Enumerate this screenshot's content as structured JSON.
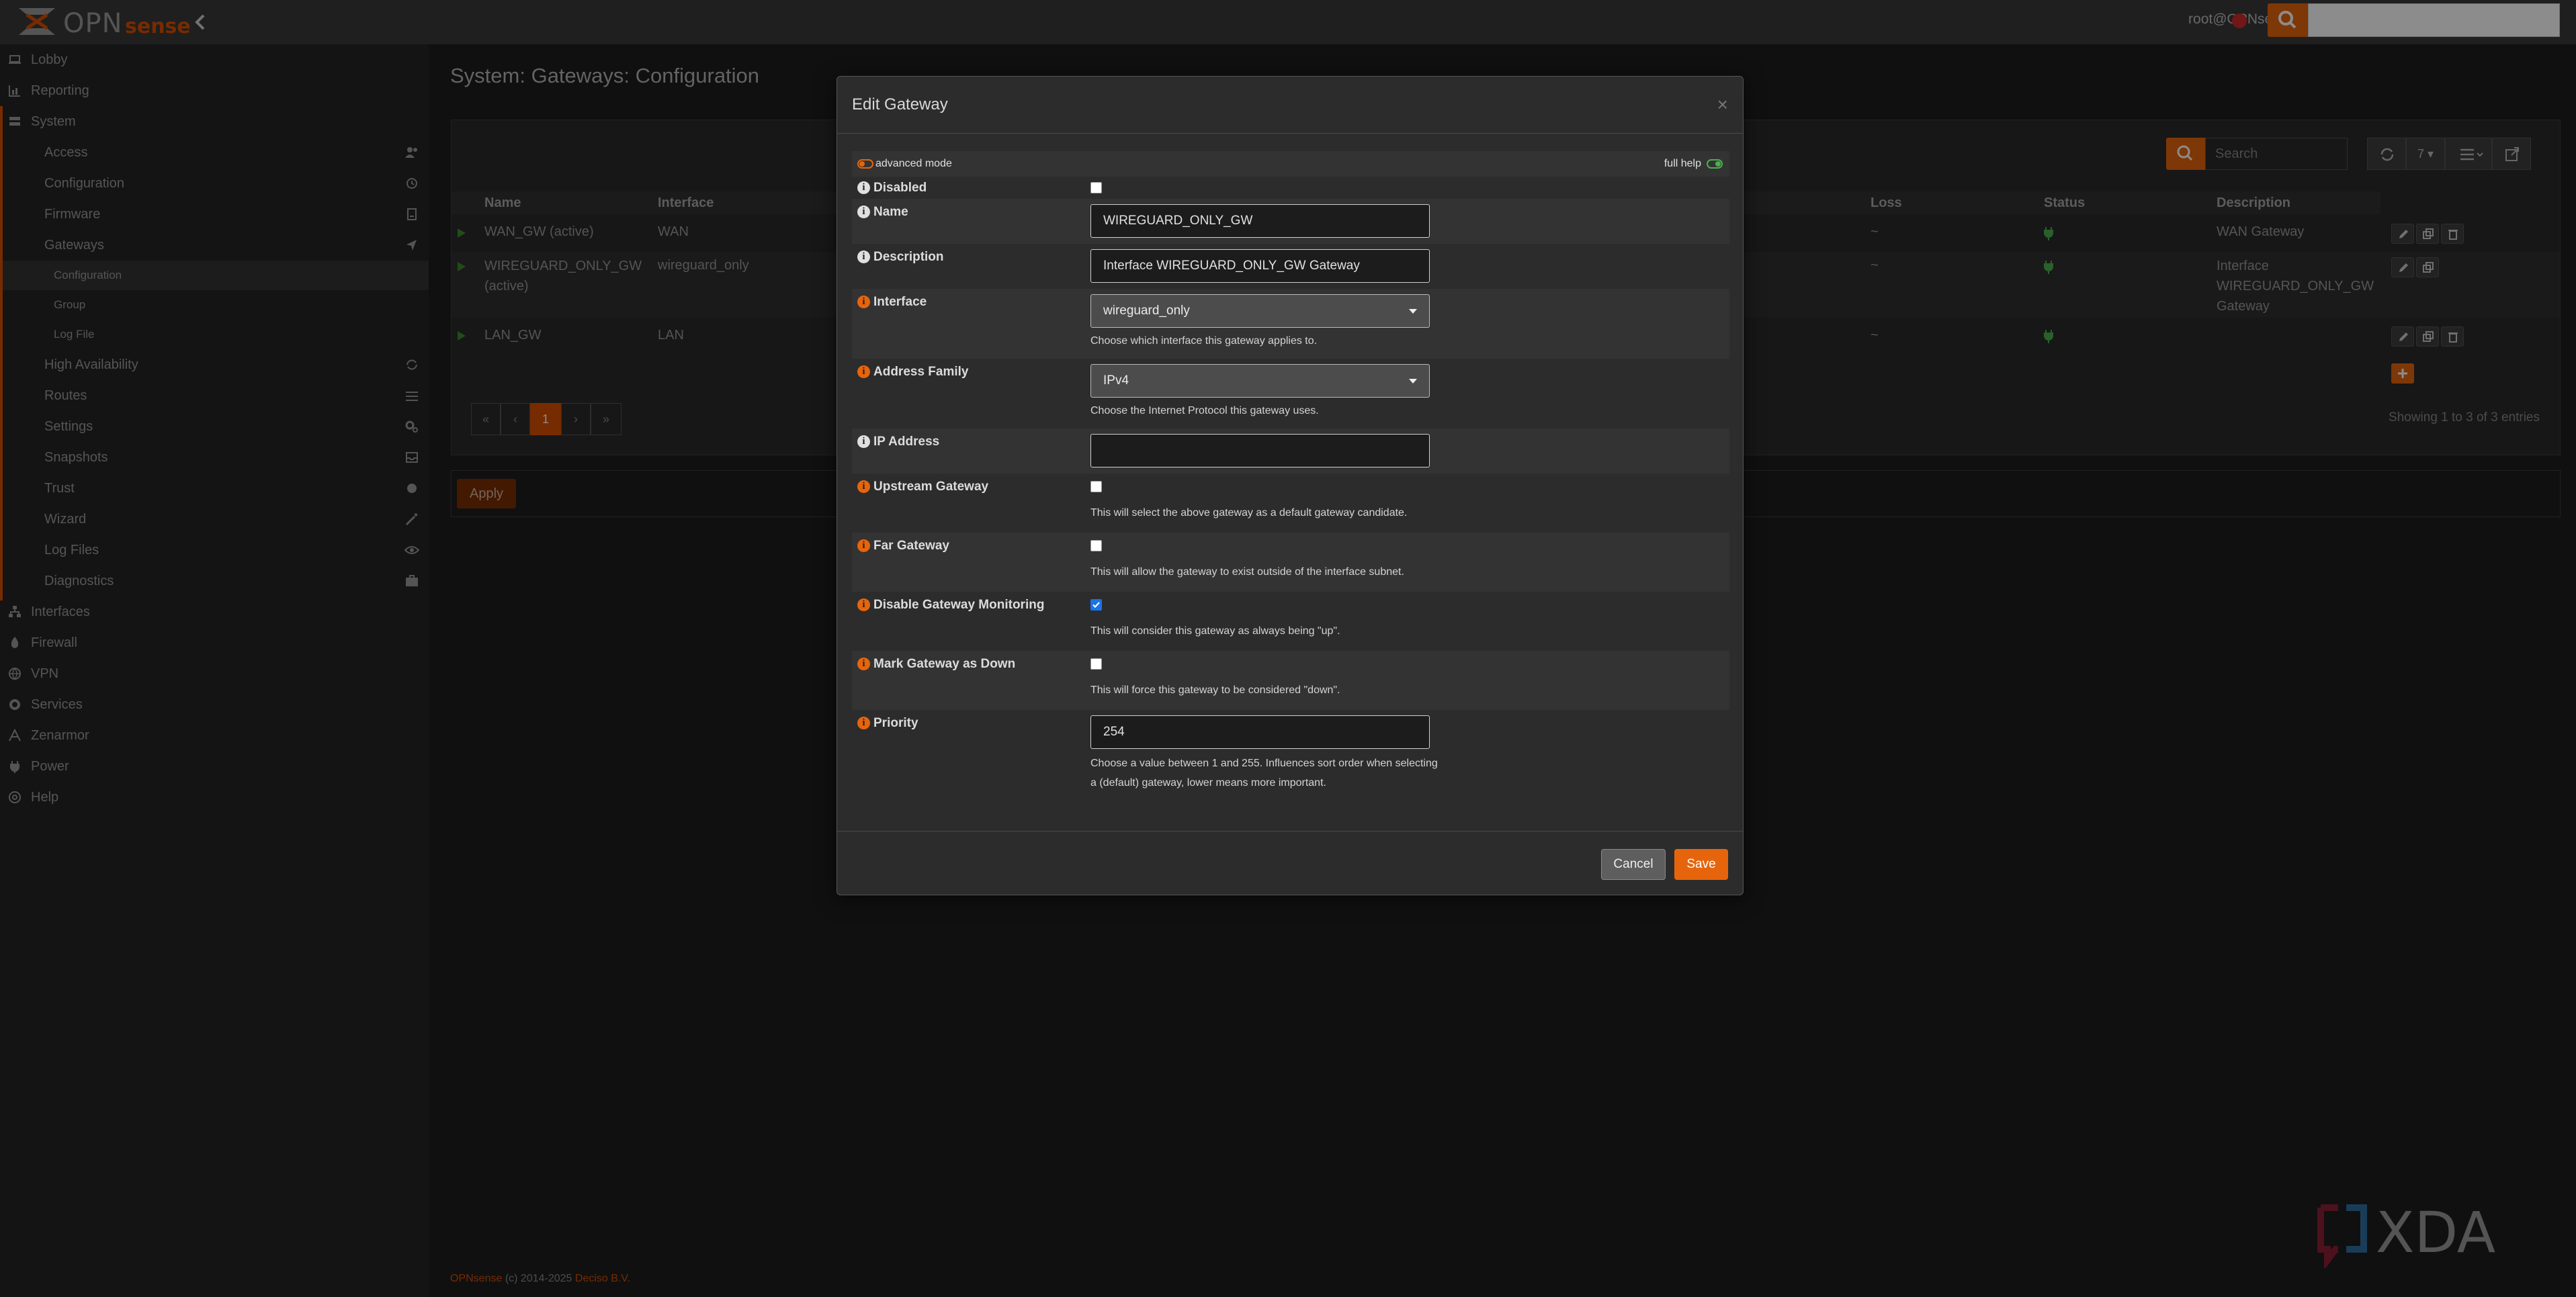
{
  "header": {
    "brand_opn": "OPN",
    "brand_sense": "sense",
    "user": "root@OPNsense.localdomain"
  },
  "sidebar": {
    "items": [
      {
        "label": "Lobby"
      },
      {
        "label": "Reporting"
      },
      {
        "label": "System"
      },
      {
        "label": "Access"
      },
      {
        "label": "Configuration"
      },
      {
        "label": "Firmware"
      },
      {
        "label": "Gateways"
      },
      {
        "label": "Configuration"
      },
      {
        "label": "Group"
      },
      {
        "label": "Log File"
      },
      {
        "label": "High Availability"
      },
      {
        "label": "Routes"
      },
      {
        "label": "Settings"
      },
      {
        "label": "Snapshots"
      },
      {
        "label": "Trust"
      },
      {
        "label": "Wizard"
      },
      {
        "label": "Log Files"
      },
      {
        "label": "Diagnostics"
      },
      {
        "label": "Interfaces"
      },
      {
        "label": "Firewall"
      },
      {
        "label": "VPN"
      },
      {
        "label": "Services"
      },
      {
        "label": "Zenarmor"
      },
      {
        "label": "Power"
      },
      {
        "label": "Help"
      }
    ]
  },
  "page": {
    "title": "System: Gateways: Configuration"
  },
  "grid": {
    "search_placeholder": "Search",
    "page_size": "7",
    "columns": {
      "name": "Name",
      "interface": "Interface",
      "loss": "Loss",
      "status": "Status",
      "description": "Description"
    },
    "rows": [
      {
        "name": "WAN_GW (active)",
        "interface": "WAN",
        "loss": "~",
        "description": "WAN Gateway"
      },
      {
        "name": "WIREGUARD_ONLY_GW (active)",
        "interface": "wireguard_only",
        "loss": "~",
        "description": "Interface WIREGUARD_ONLY_GW Gateway"
      },
      {
        "name": "LAN_GW",
        "interface": "LAN",
        "loss": "~",
        "description": ""
      }
    ],
    "pagination": {
      "first": "«",
      "prev": "‹",
      "current": "1",
      "next": "›",
      "last": "»"
    },
    "summary": "Showing 1 to 3 of 3 entries"
  },
  "apply_label": "Apply",
  "footer": {
    "brand": "OPNsense",
    "copyright": " (c) 2014-2025 ",
    "company": "Deciso B.V."
  },
  "watermark": "XDA",
  "modal": {
    "title": "Edit Gateway",
    "close": "×",
    "advanced_mode": "advanced mode",
    "full_help": "full help",
    "fields": {
      "disabled": {
        "label": "Disabled",
        "checked": false
      },
      "name": {
        "label": "Name",
        "value": "WIREGUARD_ONLY_GW"
      },
      "description": {
        "label": "Description",
        "value": "Interface WIREGUARD_ONLY_GW Gateway"
      },
      "interface": {
        "label": "Interface",
        "value": "wireguard_only",
        "help": "Choose which interface this gateway applies to."
      },
      "address_family": {
        "label": "Address Family",
        "value": "IPv4",
        "help": "Choose the Internet Protocol this gateway uses."
      },
      "ip_address": {
        "label": "IP Address",
        "value": ""
      },
      "upstream_gateway": {
        "label": "Upstream Gateway",
        "checked": false,
        "help": "This will select the above gateway as a default gateway candidate."
      },
      "far_gateway": {
        "label": "Far Gateway",
        "checked": false,
        "help": "This will allow the gateway to exist outside of the interface subnet."
      },
      "disable_monitoring": {
        "label": "Disable Gateway Monitoring",
        "checked": true,
        "help": "This will consider this gateway as always being \"up\"."
      },
      "mark_down": {
        "label": "Mark Gateway as Down",
        "checked": false,
        "help": "This will force this gateway to be considered \"down\"."
      },
      "priority": {
        "label": "Priority",
        "value": "254",
        "help": "Choose a value between 1 and 255. Influences sort order when selecting a (default) gateway, lower means more important."
      }
    },
    "cancel_label": "Cancel",
    "save_label": "Save"
  },
  "colors": {
    "accent": "#e6650c",
    "brand": "#d94f00",
    "status_ok": "#4caf50"
  }
}
